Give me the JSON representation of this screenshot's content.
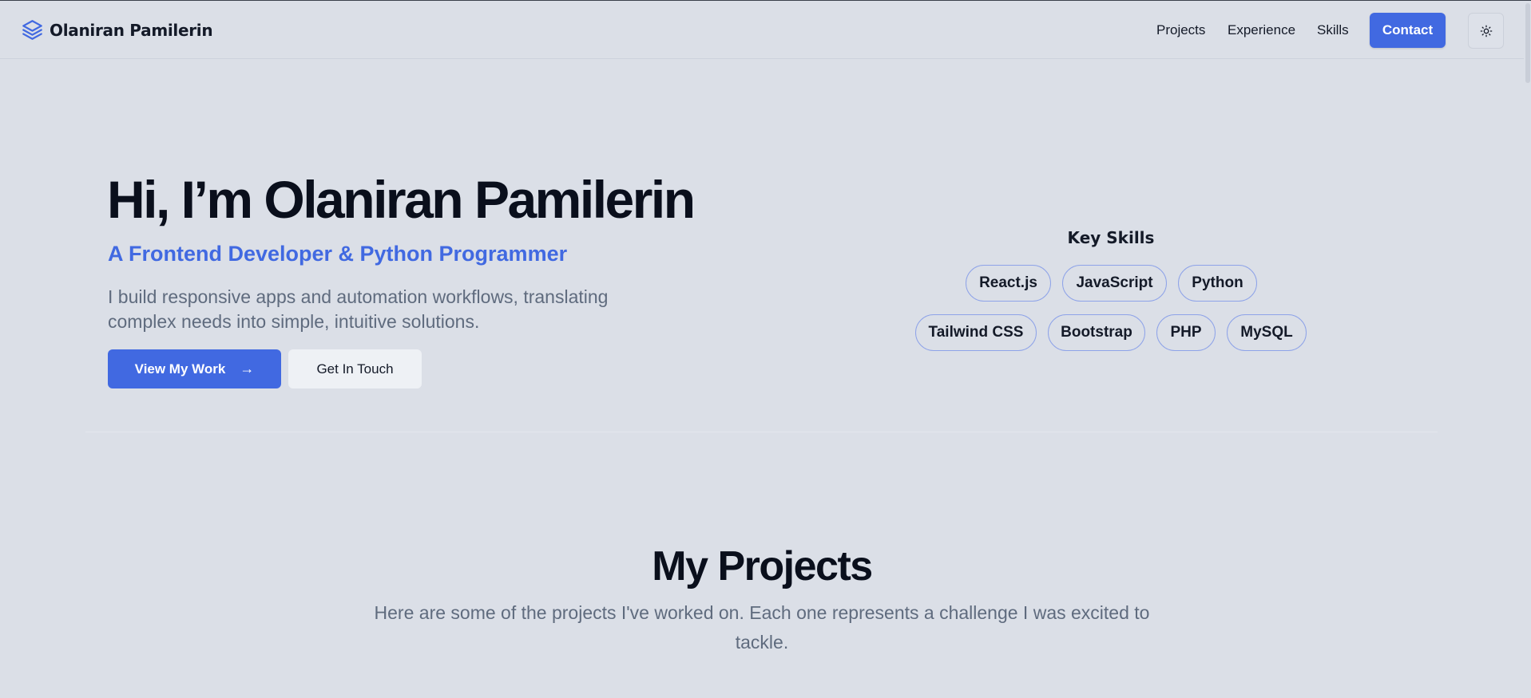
{
  "header": {
    "brand_name": "Olaniran Pamilerin",
    "brand_icon": "layers-icon",
    "nav": [
      "Projects",
      "Experience",
      "Skills"
    ],
    "contact_label": "Contact",
    "theme_icon": "sun-icon"
  },
  "hero": {
    "title": "Hi, I’m Olaniran Pamilerin",
    "subtitle": "A Frontend Developer & Python Programmer",
    "description": "I build responsive apps and automation workflows, translating complex needs into simple, intuitive solutions.",
    "primary_button": "View My Work",
    "primary_icon": "arrow-right-icon",
    "secondary_button": "Get In Touch"
  },
  "skills": {
    "title": "Key Skills",
    "items": [
      "React.js",
      "JavaScript",
      "Python",
      "Tailwind CSS",
      "Bootstrap",
      "PHP",
      "MySQL"
    ]
  },
  "projects": {
    "title": "My Projects",
    "description": "Here are some of the projects I've worked on. Each one represents a challenge I was excited to tackle."
  },
  "colors": {
    "accent": "#4169e1",
    "background": "#dbdfe7",
    "text": "#0a0f1c",
    "muted": "#5f6b7e"
  }
}
